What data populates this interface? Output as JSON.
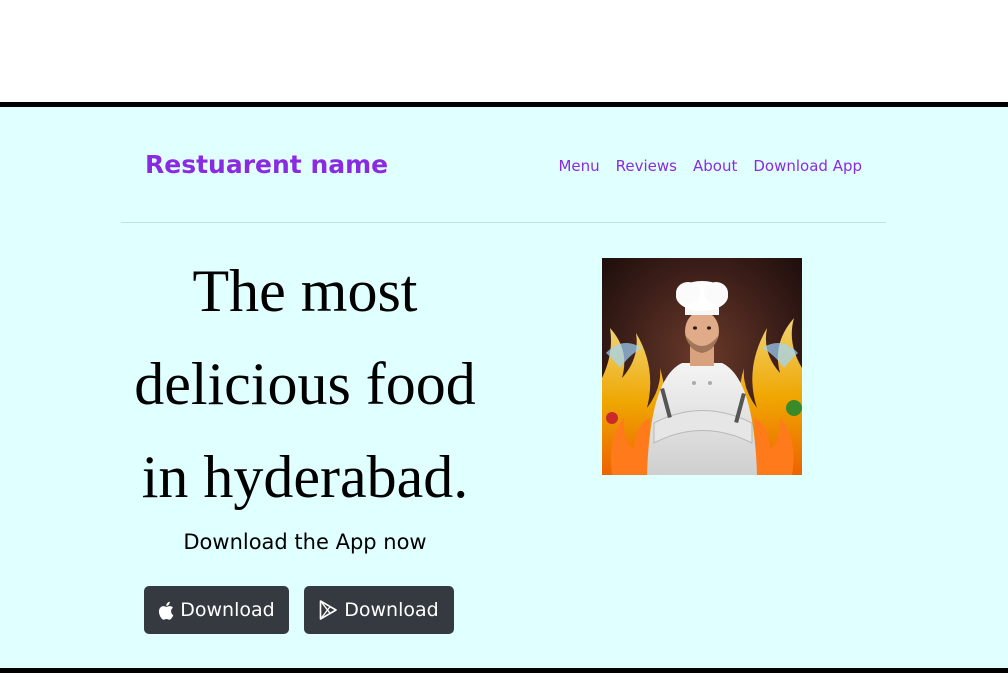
{
  "navbar": {
    "brand": "Restuarent name",
    "links": [
      "Menu",
      "Reviews",
      "About",
      "Download App"
    ]
  },
  "hero": {
    "headline_lines": [
      "The most",
      "delicious food",
      "in hyderabad."
    ],
    "subhead": "Download the App now",
    "buttons": [
      {
        "label": "Download",
        "icon": "apple-icon"
      },
      {
        "label": "Download",
        "icon": "google-play-icon"
      }
    ],
    "image": "chef-image"
  },
  "colors": {
    "hero_background": "#e0ffff",
    "brand": "#8a2be2",
    "button": "#353a40",
    "border": "#000000"
  }
}
